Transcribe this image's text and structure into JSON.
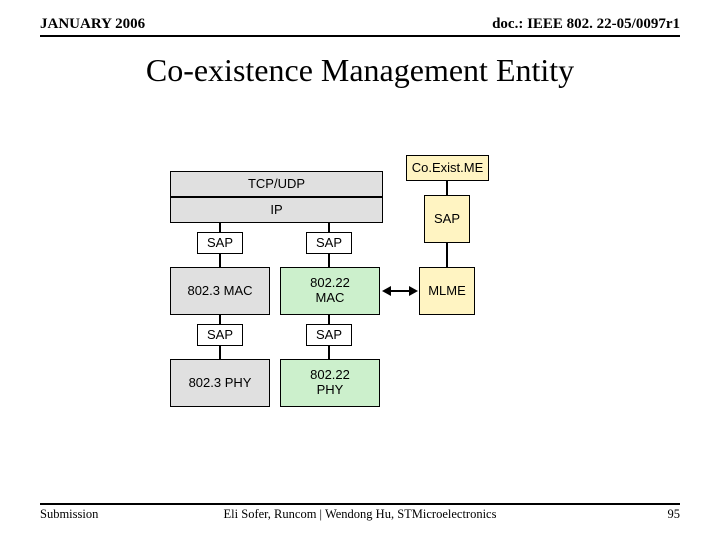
{
  "header": {
    "left": "JANUARY 2006",
    "right": "doc.: IEEE 802. 22-05/0097r1"
  },
  "title": "Co-existence Management Entity",
  "footer": {
    "left": "Submission",
    "center": "Eli Sofer, Runcom  |  Wendong Hu, STMicroelectronics",
    "page": "95"
  },
  "diagram": {
    "coexist": "Co.Exist.ME",
    "tcpudp": "TCP/UDP",
    "ip": "IP",
    "sap3_top": "SAP",
    "sap22_top": "SAP",
    "sap_me_top": "SAP",
    "mac3": "802.3 MAC",
    "mac22": "802.22\nMAC",
    "mlme": "MLME",
    "sap3_bot": "SAP",
    "sap22_bot": "SAP",
    "phy3": "802.3 PHY",
    "phy22": "802.22\nPHY"
  }
}
